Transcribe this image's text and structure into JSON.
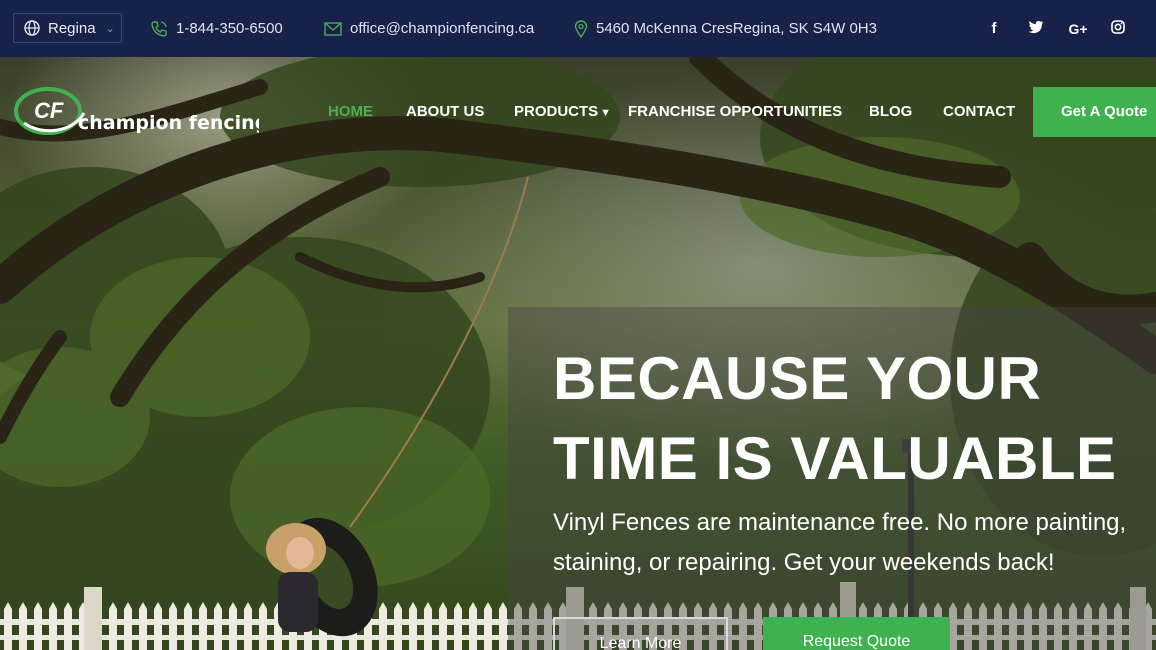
{
  "topbar": {
    "region": "Regina",
    "phone": "1-844-350-6500",
    "email": "office@championfencing.ca",
    "address": "5460 McKenna CresRegina, SK S4W 0H3",
    "social": [
      "f",
      "t",
      "G+",
      "ig"
    ]
  },
  "brand": {
    "logo_mark": "CF",
    "logo_text": "champion fencing",
    "accent": "#3fb24f",
    "navy": "#18214a"
  },
  "nav": {
    "items": [
      "HOME",
      "ABOUT US",
      "PRODUCTS",
      "FRANCHISE OPPORTUNITIES",
      "BLOG",
      "CONTACT"
    ],
    "cta": "Get A Quote"
  },
  "hero": {
    "headline_line1": "BECAUSE YOUR",
    "headline_line2": "TIME IS VALUABLE",
    "subtext": "Vinyl Fences are maintenance free. No more painting, staining, or repairing. Get your weekends back!",
    "button_more": "Learn More",
    "button_quote": "Request Quote"
  }
}
